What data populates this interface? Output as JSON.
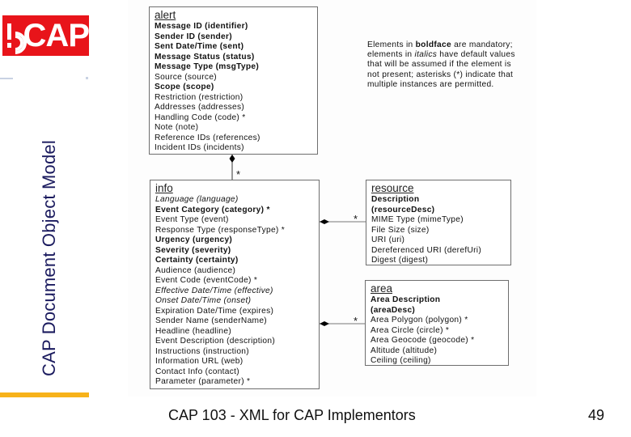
{
  "logo": {
    "text": "CAP",
    "mark": "alert-broadcast-icon"
  },
  "slide_title": "CAP Document Object Model",
  "colors": {
    "logo_red": "#e8141a",
    "accent_orange": "#f7b21a",
    "title_navy": "#1a1a5e"
  },
  "diagram": {
    "alert": {
      "title": "alert",
      "rows": [
        {
          "text": "Message ID (identifier)",
          "style": "bold"
        },
        {
          "text": "Sender ID (sender)",
          "style": "bold"
        },
        {
          "text": "Sent Date/Time (sent)",
          "style": "bold"
        },
        {
          "text": "Message Status (status)",
          "style": "bold"
        },
        {
          "text": "Message Type (msgType)",
          "style": "bold"
        },
        {
          "text": "Source (source)",
          "style": "normal"
        },
        {
          "text": "Scope (scope)",
          "style": "bold"
        },
        {
          "text": "Restriction (restriction)",
          "style": "normal"
        },
        {
          "text": "Addresses (addresses)",
          "style": "normal"
        },
        {
          "text": "Handling Code (code) *",
          "style": "normal"
        },
        {
          "text": "Note (note)",
          "style": "normal"
        },
        {
          "text": "Reference IDs (references)",
          "style": "normal"
        },
        {
          "text": "Incident IDs (incidents)",
          "style": "normal"
        }
      ]
    },
    "info": {
      "title": "info",
      "rows": [
        {
          "text": "Language (language)",
          "style": "italic"
        },
        {
          "text": "Event Category (category) *",
          "style": "bold"
        },
        {
          "text": "Event Type (event)",
          "style": "normal"
        },
        {
          "text": "Response Type (responseType) *",
          "style": "normal"
        },
        {
          "text": "Urgency (urgency)",
          "style": "bold"
        },
        {
          "text": "Severity (severity)",
          "style": "bold"
        },
        {
          "text": "Certainty (certainty)",
          "style": "bold"
        },
        {
          "text": "Audience (audience)",
          "style": "normal"
        },
        {
          "text": "Event Code (eventCode) *",
          "style": "normal"
        },
        {
          "text": "Effective Date/Time (effective)",
          "style": "italic"
        },
        {
          "text": "Onset Date/Time (onset)",
          "style": "italic"
        },
        {
          "text": "Expiration Date/Time (expires)",
          "style": "normal"
        },
        {
          "text": "Sender Name (senderName)",
          "style": "normal"
        },
        {
          "text": "Headline (headline)",
          "style": "normal"
        },
        {
          "text": "Event Description (description)",
          "style": "normal"
        },
        {
          "text": "Instructions (instruction)",
          "style": "normal"
        },
        {
          "text": "Information URL (web)",
          "style": "normal"
        },
        {
          "text": "Contact Info (contact)",
          "style": "normal"
        },
        {
          "text": "Parameter (parameter) *",
          "style": "normal"
        }
      ]
    },
    "resource": {
      "title": "resource",
      "rows": [
        {
          "text": "Description",
          "style": "bold"
        },
        {
          "text": "(resourceDesc)",
          "style": "bold"
        },
        {
          "text": "MIME Type (mimeType)",
          "style": "normal"
        },
        {
          "text": "File Size (size)",
          "style": "normal"
        },
        {
          "text": "URI (uri)",
          "style": "normal"
        },
        {
          "text": "Dereferenced URI (derefUri)",
          "style": "normal"
        },
        {
          "text": "Digest (digest)",
          "style": "normal"
        }
      ]
    },
    "area": {
      "title": "area",
      "rows": [
        {
          "text": "Area Description",
          "style": "bold"
        },
        {
          "text": "(areaDesc)",
          "style": "bold"
        },
        {
          "text": "Area Polygon (polygon) *",
          "style": "normal"
        },
        {
          "text": "Area Circle (circle) *",
          "style": "normal"
        },
        {
          "text": "Area Geocode (geocode) *",
          "style": "normal"
        },
        {
          "text": "Altitude (altitude)",
          "style": "normal"
        },
        {
          "text": "Ceiling (ceiling)",
          "style": "normal"
        }
      ]
    },
    "multiplicity": "*",
    "note": {
      "p1": "Elements in ",
      "bold_word": "boldface",
      "p2": " are mandatory; elements in ",
      "italic_word": "italics",
      "p3": " have default values that will be assumed if the element is not present; asterisks (*) indicate that multiple instances are permitted."
    }
  },
  "footer": {
    "text": "CAP 103 - XML for CAP Implementors",
    "page": "49"
  }
}
